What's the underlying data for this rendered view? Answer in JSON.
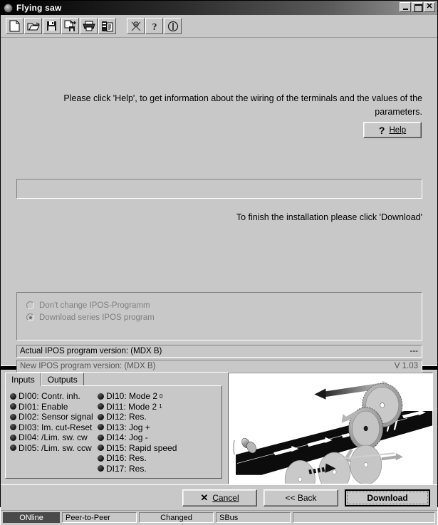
{
  "window": {
    "title": "Flying saw",
    "icon": "app-circle-icon",
    "buttons": {
      "minimize": "_",
      "maximize": "□",
      "close": "✕"
    }
  },
  "toolbar": {
    "items": [
      {
        "name": "new-file-icon",
        "tooltip": "New"
      },
      {
        "name": "open-folder-icon",
        "tooltip": "Open"
      },
      {
        "name": "save-disk-icon",
        "tooltip": "Save"
      },
      {
        "name": "save-as-icon",
        "tooltip": "Save as"
      },
      {
        "name": "print-icon",
        "tooltip": "Print"
      },
      {
        "name": "copy-document-icon",
        "tooltip": "Copy"
      },
      {
        "name": "network-tool-icon",
        "tooltip": "Tool"
      },
      {
        "name": "help-question-icon",
        "tooltip": "Help"
      },
      {
        "name": "info-icon",
        "tooltip": "Info"
      }
    ]
  },
  "main": {
    "instruction": "Please click 'Help', to get information about the wiring of the terminals and the values of the parameters.",
    "help_button": {
      "icon": "question-mark-icon",
      "label_pre": "",
      "label_mnemonic": "H",
      "label_rest": "elp",
      "label": "Help"
    },
    "finish_text": "To finish the installation please click 'Download'",
    "radio_options": [
      {
        "label": "Don't change IPOS-Programm",
        "selected": false,
        "disabled": true
      },
      {
        "label": "Download series IPOS program",
        "selected": true,
        "disabled": true
      }
    ],
    "version_rows": [
      {
        "label": "Actual IPOS program version: (MDX B)",
        "value": "---"
      },
      {
        "label": "New IPOS program version: (MDX B)",
        "value": "V  1.03"
      }
    ]
  },
  "bottom": {
    "tabs": [
      {
        "label": "Inputs",
        "active": true
      },
      {
        "label": "Outputs",
        "active": false
      }
    ],
    "inputs_left": [
      {
        "id": "DI00",
        "text": "DI00: Contr. inh."
      },
      {
        "id": "DI01",
        "text": "DI01: Enable"
      },
      {
        "id": "DI02",
        "text": "DI02: Sensor signal"
      },
      {
        "id": "DI03",
        "text": "DI03: Im. cut-Reset"
      },
      {
        "id": "DI04",
        "text": "DI04: /Lim. sw. cw"
      },
      {
        "id": "DI05",
        "text": "DI05: /Lim. sw. ccw"
      }
    ],
    "inputs_right": [
      {
        "id": "DI10",
        "text": "DI10: Mode 2",
        "sup": "0"
      },
      {
        "id": "DI11",
        "text": "DI11: Mode 2",
        "sup": "1"
      },
      {
        "id": "DI12",
        "text": "DI12: Res.",
        "sup": ""
      },
      {
        "id": "DI13",
        "text": "DI13: Jog +",
        "sup": ""
      },
      {
        "id": "DI14",
        "text": "DI14: Jog -",
        "sup": ""
      },
      {
        "id": "DI15",
        "text": "DI15: Rapid speed",
        "sup": ""
      },
      {
        "id": "DI16",
        "text": "DI16: Res.",
        "sup": ""
      },
      {
        "id": "DI17",
        "text": "DI17: Res.",
        "sup": ""
      }
    ],
    "illustration": "flying-saw-conveyor-diagram"
  },
  "buttons": {
    "cancel": "Cancel",
    "back": "<< Back",
    "download": "Download"
  },
  "statusbar": {
    "connection": "ONline",
    "protocol": "Peer-to-Peer",
    "state": "Changed",
    "bus": "SBus",
    "empty": ""
  },
  "colors": {
    "face": "#c8c8c8",
    "title_start": "#000000",
    "title_end": "#9a9a9a",
    "disabled_text": "#808080",
    "status_highlight": "#4a4a4a"
  }
}
